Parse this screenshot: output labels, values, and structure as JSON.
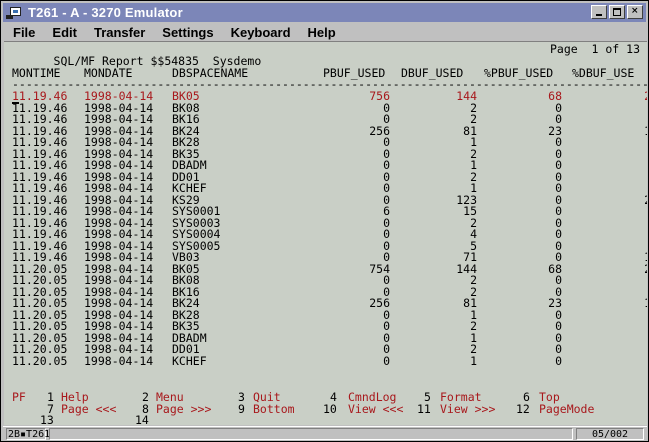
{
  "window": {
    "title": "T261 - A - 3270 Emulator"
  },
  "menu": [
    "File",
    "Edit",
    "Transfer",
    "Settings",
    "Keyboard",
    "Help"
  ],
  "report": {
    "title": "SQL/MF Report $$54835  Sysdemo",
    "page": "Page  1 of 13",
    "headers": [
      "MONTIME",
      "MONDATE",
      "DBSPACENAME",
      "PBUF_USED",
      "DBUF_USED",
      "%PBUF_USED",
      "%DBUF_USE"
    ],
    "separator": "---------------------------------------------------------------------------------------------------",
    "rows": [
      {
        "time": "11.19.46",
        "date": "1998-04-14",
        "name": "BK05",
        "pbuf": "756",
        "dbuf": "144",
        "ppct": "68",
        "dpct": "2",
        "hl": true
      },
      {
        "time": "11.19.46",
        "date": "1998-04-14",
        "name": "BK08",
        "pbuf": "0",
        "dbuf": "2",
        "ppct": "0",
        "dpct": "",
        "hl": false
      },
      {
        "time": "11.19.46",
        "date": "1998-04-14",
        "name": "BK16",
        "pbuf": "0",
        "dbuf": "2",
        "ppct": "0",
        "dpct": "",
        "hl": false
      },
      {
        "time": "11.19.46",
        "date": "1998-04-14",
        "name": "BK24",
        "pbuf": "256",
        "dbuf": "81",
        "ppct": "23",
        "dpct": "1",
        "hl": false
      },
      {
        "time": "11.19.46",
        "date": "1998-04-14",
        "name": "BK28",
        "pbuf": "0",
        "dbuf": "1",
        "ppct": "0",
        "dpct": "",
        "hl": false
      },
      {
        "time": "11.19.46",
        "date": "1998-04-14",
        "name": "BK35",
        "pbuf": "0",
        "dbuf": "2",
        "ppct": "0",
        "dpct": "",
        "hl": false
      },
      {
        "time": "11.19.46",
        "date": "1998-04-14",
        "name": "DBADM",
        "pbuf": "0",
        "dbuf": "1",
        "ppct": "0",
        "dpct": "",
        "hl": false
      },
      {
        "time": "11.19.46",
        "date": "1998-04-14",
        "name": "DD01",
        "pbuf": "0",
        "dbuf": "2",
        "ppct": "0",
        "dpct": "",
        "hl": false
      },
      {
        "time": "11.19.46",
        "date": "1998-04-14",
        "name": "KCHEF",
        "pbuf": "0",
        "dbuf": "1",
        "ppct": "0",
        "dpct": "",
        "hl": false
      },
      {
        "time": "11.19.46",
        "date": "1998-04-14",
        "name": "KS29",
        "pbuf": "0",
        "dbuf": "123",
        "ppct": "0",
        "dpct": "2",
        "hl": false
      },
      {
        "time": "11.19.46",
        "date": "1998-04-14",
        "name": "SYS0001",
        "pbuf": "6",
        "dbuf": "15",
        "ppct": "0",
        "dpct": "",
        "hl": false
      },
      {
        "time": "11.19.46",
        "date": "1998-04-14",
        "name": "SYS0003",
        "pbuf": "0",
        "dbuf": "2",
        "ppct": "0",
        "dpct": "",
        "hl": false
      },
      {
        "time": "11.19.46",
        "date": "1998-04-14",
        "name": "SYS0004",
        "pbuf": "0",
        "dbuf": "4",
        "ppct": "0",
        "dpct": "",
        "hl": false
      },
      {
        "time": "11.19.46",
        "date": "1998-04-14",
        "name": "SYS0005",
        "pbuf": "0",
        "dbuf": "5",
        "ppct": "0",
        "dpct": "",
        "hl": false
      },
      {
        "time": "11.19.46",
        "date": "1998-04-14",
        "name": "VB03",
        "pbuf": "0",
        "dbuf": "71",
        "ppct": "0",
        "dpct": "1",
        "hl": false
      },
      {
        "time": "11.20.05",
        "date": "1998-04-14",
        "name": "BK05",
        "pbuf": "754",
        "dbuf": "144",
        "ppct": "68",
        "dpct": "2",
        "hl": false
      },
      {
        "time": "11.20.05",
        "date": "1998-04-14",
        "name": "BK08",
        "pbuf": "0",
        "dbuf": "2",
        "ppct": "0",
        "dpct": "",
        "hl": false
      },
      {
        "time": "11.20.05",
        "date": "1998-04-14",
        "name": "BK16",
        "pbuf": "0",
        "dbuf": "2",
        "ppct": "0",
        "dpct": "",
        "hl": false
      },
      {
        "time": "11.20.05",
        "date": "1998-04-14",
        "name": "BK24",
        "pbuf": "256",
        "dbuf": "81",
        "ppct": "23",
        "dpct": "1",
        "hl": false
      },
      {
        "time": "11.20.05",
        "date": "1998-04-14",
        "name": "BK28",
        "pbuf": "0",
        "dbuf": "1",
        "ppct": "0",
        "dpct": "",
        "hl": false
      },
      {
        "time": "11.20.05",
        "date": "1998-04-14",
        "name": "BK35",
        "pbuf": "0",
        "dbuf": "2",
        "ppct": "0",
        "dpct": "",
        "hl": false
      },
      {
        "time": "11.20.05",
        "date": "1998-04-14",
        "name": "DBADM",
        "pbuf": "0",
        "dbuf": "1",
        "ppct": "0",
        "dpct": "",
        "hl": false
      },
      {
        "time": "11.20.05",
        "date": "1998-04-14",
        "name": "DD01",
        "pbuf": "0",
        "dbuf": "2",
        "ppct": "0",
        "dpct": "",
        "hl": false
      },
      {
        "time": "11.20.05",
        "date": "1998-04-14",
        "name": "KCHEF",
        "pbuf": "0",
        "dbuf": "1",
        "ppct": "0",
        "dpct": "",
        "hl": false
      }
    ]
  },
  "pfkeys": {
    "prefix": "PF",
    "line1": [
      {
        "n": "1",
        "label": "Help"
      },
      {
        "n": "2",
        "label": "Menu"
      },
      {
        "n": "3",
        "label": "Quit"
      },
      {
        "n": "4",
        "label": "CmndLog"
      },
      {
        "n": "5",
        "label": "Format"
      },
      {
        "n": "6",
        "label": "Top"
      }
    ],
    "line2": [
      {
        "n": "7",
        "label": "Page <<<"
      },
      {
        "n": "8",
        "label": "Page >>>"
      },
      {
        "n": "9",
        "label": "Bottom"
      },
      {
        "n": "10",
        "label": "View <<<"
      },
      {
        "n": "11",
        "label": "View >>>"
      },
      {
        "n": "12",
        "label": "PageMode"
      }
    ],
    "line3": [
      "13",
      "14"
    ]
  },
  "status": {
    "session": "2B▪T261",
    "position": "05/002"
  },
  "colors": {
    "screen_bg": "#c9cfc6",
    "highlight": "#a8181c",
    "titlebar": "#7c86b8"
  }
}
